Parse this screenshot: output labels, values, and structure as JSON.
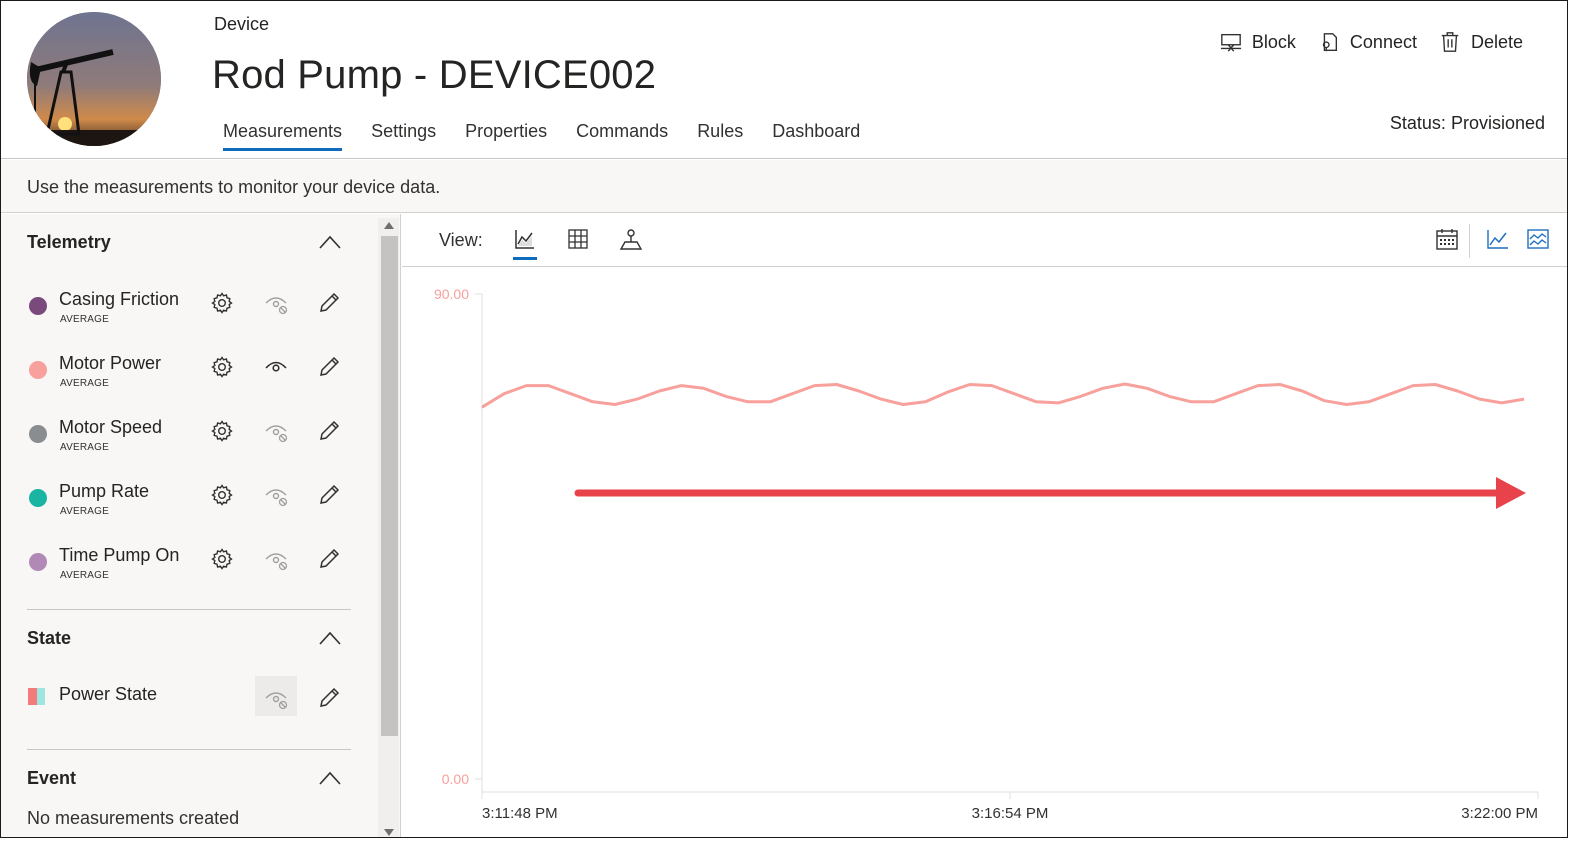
{
  "header": {
    "breadcrumb": "Device",
    "title": "Rod Pump - DEVICE002",
    "tabs": [
      {
        "label": "Measurements",
        "active": true
      },
      {
        "label": "Settings"
      },
      {
        "label": "Properties"
      },
      {
        "label": "Commands"
      },
      {
        "label": "Rules"
      },
      {
        "label": "Dashboard"
      }
    ],
    "actions": [
      {
        "label": "Block",
        "icon": "block-icon"
      },
      {
        "label": "Connect",
        "icon": "connect-icon"
      },
      {
        "label": "Delete",
        "icon": "trash-icon"
      }
    ],
    "status": "Status: Provisioned"
  },
  "infobar": {
    "text": "Use the measurements to monitor your device data."
  },
  "sidebar": {
    "telemetry": {
      "heading": "Telemetry",
      "items": [
        {
          "name": "Casing Friction",
          "agg": "AVERAGE",
          "color": "#7a4a7c",
          "visible": false
        },
        {
          "name": "Motor Power",
          "agg": "AVERAGE",
          "color": "#f7a09c",
          "visible": true
        },
        {
          "name": "Motor Speed",
          "agg": "AVERAGE",
          "color": "#8a8d90",
          "visible": false
        },
        {
          "name": "Pump Rate",
          "agg": "AVERAGE",
          "color": "#1ab5a2",
          "visible": false
        },
        {
          "name": "Time Pump On",
          "agg": "AVERAGE",
          "color": "#b288b6",
          "visible": false
        }
      ]
    },
    "state": {
      "heading": "State",
      "items": [
        {
          "name": "Power State"
        }
      ]
    },
    "event": {
      "heading": "Event",
      "empty": "No measurements created"
    }
  },
  "main": {
    "view_label": "View:"
  },
  "chart_data": {
    "type": "line",
    "ylim": [
      0,
      90
    ],
    "y_ticks": [
      "90.00",
      "0.00"
    ],
    "x_ticks": [
      "3:11:48 PM",
      "3:16:54 PM",
      "3:22:00 PM"
    ],
    "series": [
      {
        "color": "#f7a09c",
        "values": [
          69,
          71.5,
          73,
          73,
          71.5,
          70,
          69.5,
          70.5,
          72,
          73,
          72.5,
          71,
          70,
          70,
          71.5,
          73,
          73.2,
          72,
          70.5,
          69.5,
          70,
          71.8,
          73.2,
          73,
          71.5,
          70,
          69.8,
          71,
          72.5,
          73.3,
          72.5,
          71,
          70,
          70,
          71.5,
          73,
          73.2,
          72,
          70.2,
          69.5,
          70,
          71.5,
          73,
          73.2,
          72,
          70.5,
          69.8,
          70.5
        ]
      }
    ],
    "annotation_arrow_color": "#e8434a"
  }
}
